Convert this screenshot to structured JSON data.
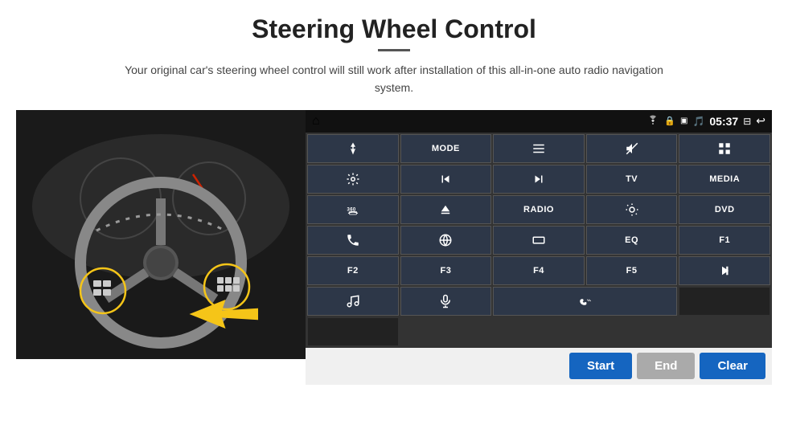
{
  "page": {
    "title": "Steering Wheel Control",
    "subtitle": "Your original car's steering wheel control will still work after installation of this all-in-one auto radio navigation system.",
    "divider": true
  },
  "status_bar": {
    "home_icon": "⌂",
    "wifi_icon": "wifi",
    "lock_icon": "🔒",
    "sim_icon": "SIM",
    "bluetooth_icon": "BT",
    "time": "05:37",
    "screen_icon": "SCR",
    "back_icon": "↩"
  },
  "buttons": [
    {
      "id": "btn-nav",
      "type": "icon",
      "icon": "nav",
      "label": ""
    },
    {
      "id": "btn-mode",
      "type": "text",
      "label": "MODE"
    },
    {
      "id": "btn-list",
      "type": "icon",
      "icon": "list",
      "label": ""
    },
    {
      "id": "btn-mute",
      "type": "icon",
      "icon": "mute",
      "label": ""
    },
    {
      "id": "btn-apps",
      "type": "icon",
      "icon": "apps",
      "label": ""
    },
    {
      "id": "btn-settings",
      "type": "icon",
      "icon": "settings",
      "label": ""
    },
    {
      "id": "btn-prev",
      "type": "icon",
      "icon": "prev",
      "label": ""
    },
    {
      "id": "btn-next",
      "type": "icon",
      "icon": "next",
      "label": ""
    },
    {
      "id": "btn-tv",
      "type": "text",
      "label": "TV"
    },
    {
      "id": "btn-media",
      "type": "text",
      "label": "MEDIA"
    },
    {
      "id": "btn-360",
      "type": "icon",
      "icon": "360",
      "label": ""
    },
    {
      "id": "btn-eject",
      "type": "icon",
      "icon": "eject",
      "label": ""
    },
    {
      "id": "btn-radio",
      "type": "text",
      "label": "RADIO"
    },
    {
      "id": "btn-brightness",
      "type": "icon",
      "icon": "brightness",
      "label": ""
    },
    {
      "id": "btn-dvd",
      "type": "text",
      "label": "DVD"
    },
    {
      "id": "btn-phone",
      "type": "icon",
      "icon": "phone",
      "label": ""
    },
    {
      "id": "btn-browser",
      "type": "icon",
      "icon": "browser",
      "label": ""
    },
    {
      "id": "btn-rectangle",
      "type": "icon",
      "icon": "rect",
      "label": ""
    },
    {
      "id": "btn-eq",
      "type": "text",
      "label": "EQ"
    },
    {
      "id": "btn-f1",
      "type": "text",
      "label": "F1"
    },
    {
      "id": "btn-f2",
      "type": "text",
      "label": "F2"
    },
    {
      "id": "btn-f3",
      "type": "text",
      "label": "F3"
    },
    {
      "id": "btn-f4",
      "type": "text",
      "label": "F4"
    },
    {
      "id": "btn-f5",
      "type": "text",
      "label": "F5"
    },
    {
      "id": "btn-playpause",
      "type": "icon",
      "icon": "playpause",
      "label": ""
    },
    {
      "id": "btn-music",
      "type": "icon",
      "icon": "music",
      "label": ""
    },
    {
      "id": "btn-mic",
      "type": "icon",
      "icon": "mic",
      "label": ""
    },
    {
      "id": "btn-call",
      "type": "icon-wide",
      "icon": "call",
      "label": ""
    },
    {
      "id": "btn-empty1",
      "type": "empty",
      "label": ""
    },
    {
      "id": "btn-empty2",
      "type": "empty",
      "label": ""
    }
  ],
  "bottom_bar": {
    "start_label": "Start",
    "end_label": "End",
    "clear_label": "Clear"
  }
}
